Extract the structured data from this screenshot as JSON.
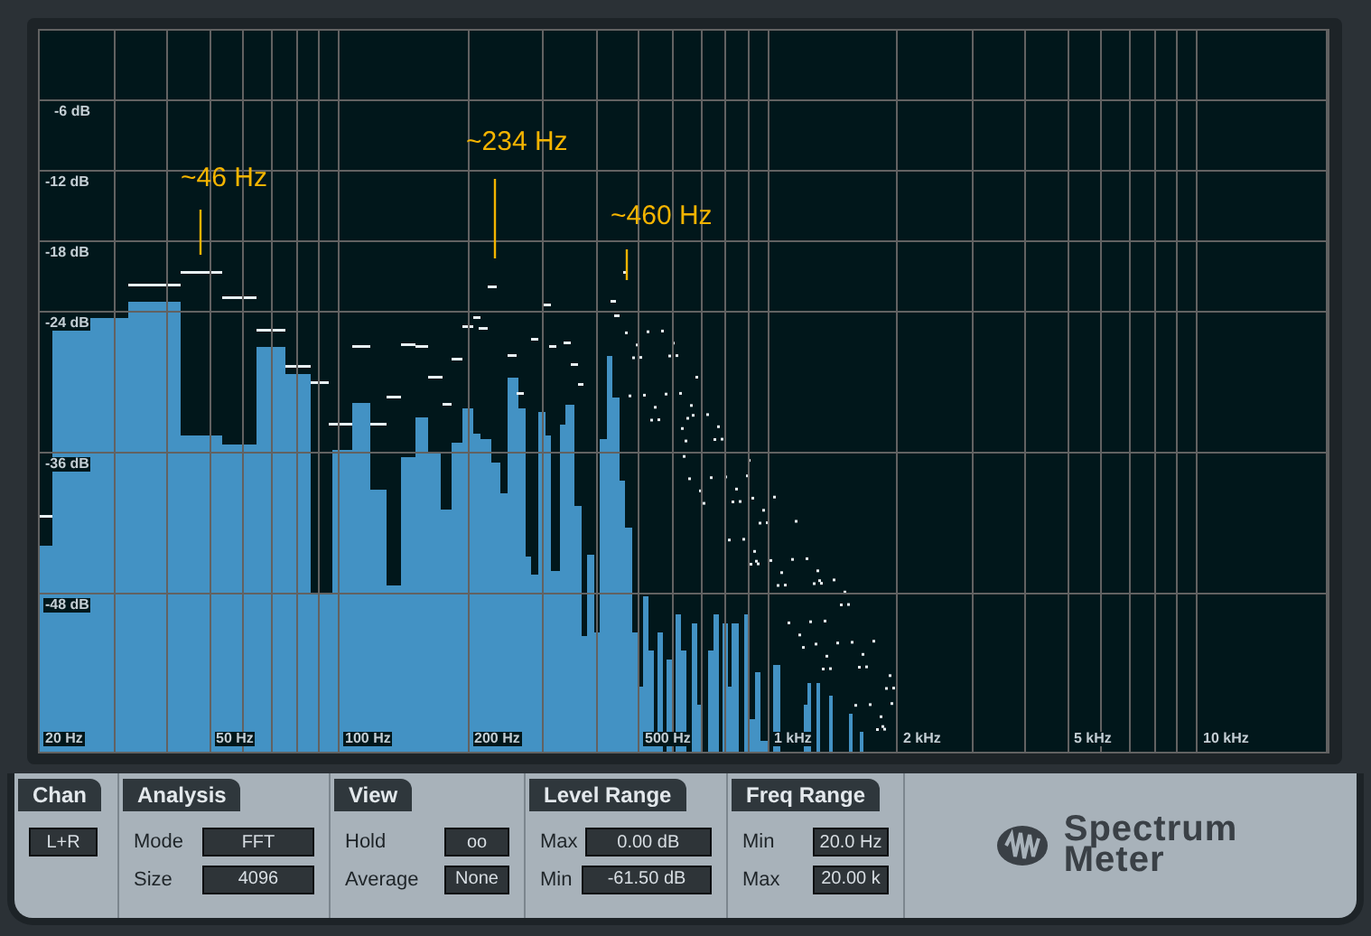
{
  "spectrum": {
    "y_labels": [
      "-6 dB",
      "-12 dB",
      "-18 dB",
      "-24 dB",
      "-36 dB",
      "-48 dB"
    ],
    "x_labels": [
      "20 Hz",
      "50 Hz",
      "100 Hz",
      "200 Hz",
      "500 Hz",
      "1 kHz",
      "2 kHz",
      "5 kHz",
      "10 kHz"
    ],
    "annotations": [
      "~46 Hz",
      "~234 Hz",
      "~460 Hz"
    ]
  },
  "sections": [
    {
      "title": "Chan",
      "fields": [
        {
          "value": "L+R"
        }
      ]
    },
    {
      "title": "Analysis",
      "fields": [
        {
          "label": "Mode",
          "value": "FFT"
        },
        {
          "label": "Size",
          "value": "4096"
        }
      ]
    },
    {
      "title": "View",
      "fields": [
        {
          "label": "Hold",
          "value": "oo"
        },
        {
          "label": "Average",
          "value": "None"
        }
      ]
    },
    {
      "title": "Level Range",
      "fields": [
        {
          "label": "Max",
          "value": "0.00 dB"
        },
        {
          "label": "Min",
          "value": "-61.50 dB"
        }
      ]
    },
    {
      "title": "Freq Range",
      "fields": [
        {
          "label": "Min",
          "value": "20.0 Hz"
        },
        {
          "label": "Max",
          "value": "20.00 k"
        }
      ]
    }
  ],
  "logo": {
    "lines": [
      "Spectrum",
      "Meter"
    ]
  }
}
